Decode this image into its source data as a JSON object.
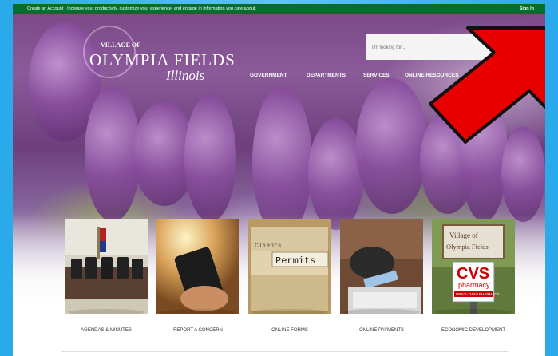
{
  "topbar": {
    "message": "Create an Account - Increase your productivity, customize your experience, and engage in information you care about.",
    "sign_in": "Sign In"
  },
  "logo": {
    "village_of": "VILLAGE OF",
    "name": "OLYMPIA FIELDS",
    "state": "Illinois"
  },
  "nav": {
    "government": "GOVERNMENT",
    "departments": "DEPARTMENTS",
    "services": "SERVICES",
    "online_resources": "ONLINE RESOURCES"
  },
  "search": {
    "placeholder": "I'm looking for..."
  },
  "tiles": [
    {
      "label": "AGENDAS & MINUTES"
    },
    {
      "label": "REPORT A CONCERN"
    },
    {
      "label": "ONLINE FORMS",
      "sign_top": "Clients",
      "sign_main": "Permits"
    },
    {
      "label": "ONLINE PAYMENTS"
    },
    {
      "label": "ECONOMIC DEVELOPMENT",
      "sign_line1": "Village of",
      "sign_line2": "Olympia Fields",
      "store_brand": "CVS",
      "store_sub": "pharmacy",
      "store_tag": "DRIVE-THRU PHARMACY"
    }
  ],
  "colors": {
    "topbar": "#0b6b2e",
    "arrow": "#e80000",
    "background": "#29a9ea"
  }
}
